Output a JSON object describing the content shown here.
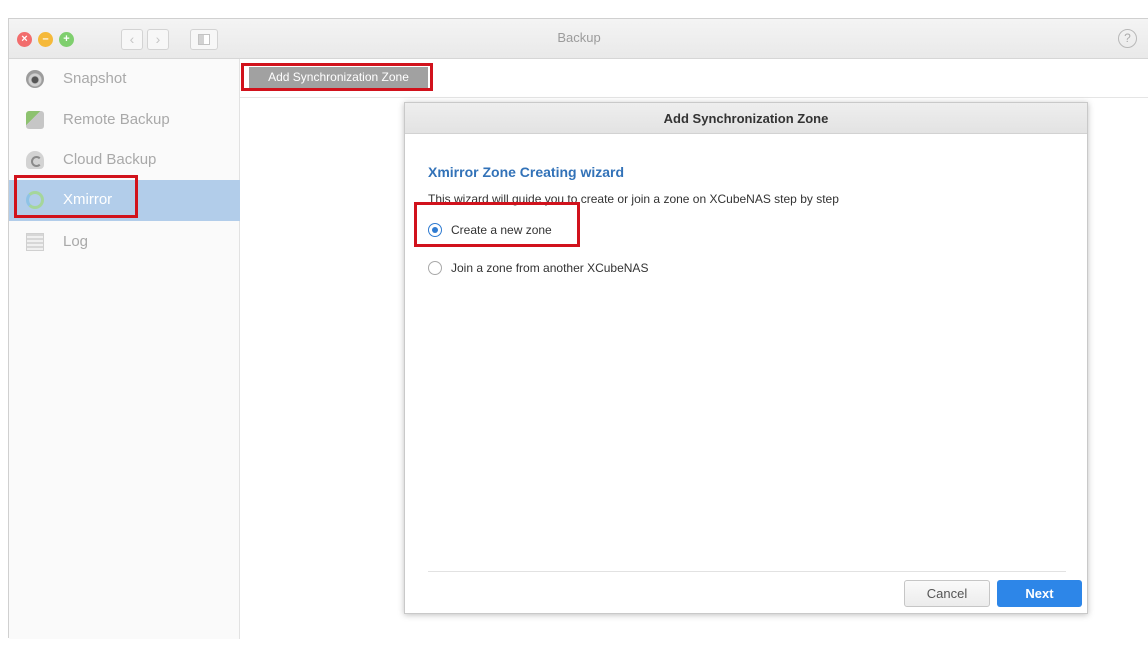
{
  "window": {
    "title": "Backup",
    "controls": {
      "close_glyph": "×",
      "minimize_glyph": "–",
      "maximize_glyph": "+"
    },
    "nav": {
      "back_glyph": "‹",
      "forward_glyph": "›"
    },
    "help_glyph": "?"
  },
  "sidebar": {
    "items": [
      {
        "label": "Snapshot",
        "icon": "snapshot-icon"
      },
      {
        "label": "Remote Backup",
        "icon": "remote-backup-icon"
      },
      {
        "label": "Cloud Backup",
        "icon": "cloud-backup-icon"
      },
      {
        "label": "Xmirror",
        "icon": "xmirror-icon",
        "active": true
      },
      {
        "label": "Log",
        "icon": "log-icon"
      }
    ]
  },
  "toolbar": {
    "add_zone_label": "Add Synchronization Zone"
  },
  "dialog": {
    "title": "Add Synchronization Zone",
    "wizard_title": "Xmirror Zone Creating wizard",
    "description": "This wizard will guide you to create or join a zone on XCubeNAS step by step",
    "options": [
      {
        "label": "Create a new zone",
        "selected": true
      },
      {
        "label": "Join a zone from another XCubeNAS",
        "selected": false
      }
    ],
    "cancel_label": "Cancel",
    "next_label": "Next"
  },
  "colors": {
    "accent": "#2d86e8",
    "wizard_title": "#3272b8",
    "sidebar_active": "#b2cdea",
    "highlight": "#d1121c"
  }
}
